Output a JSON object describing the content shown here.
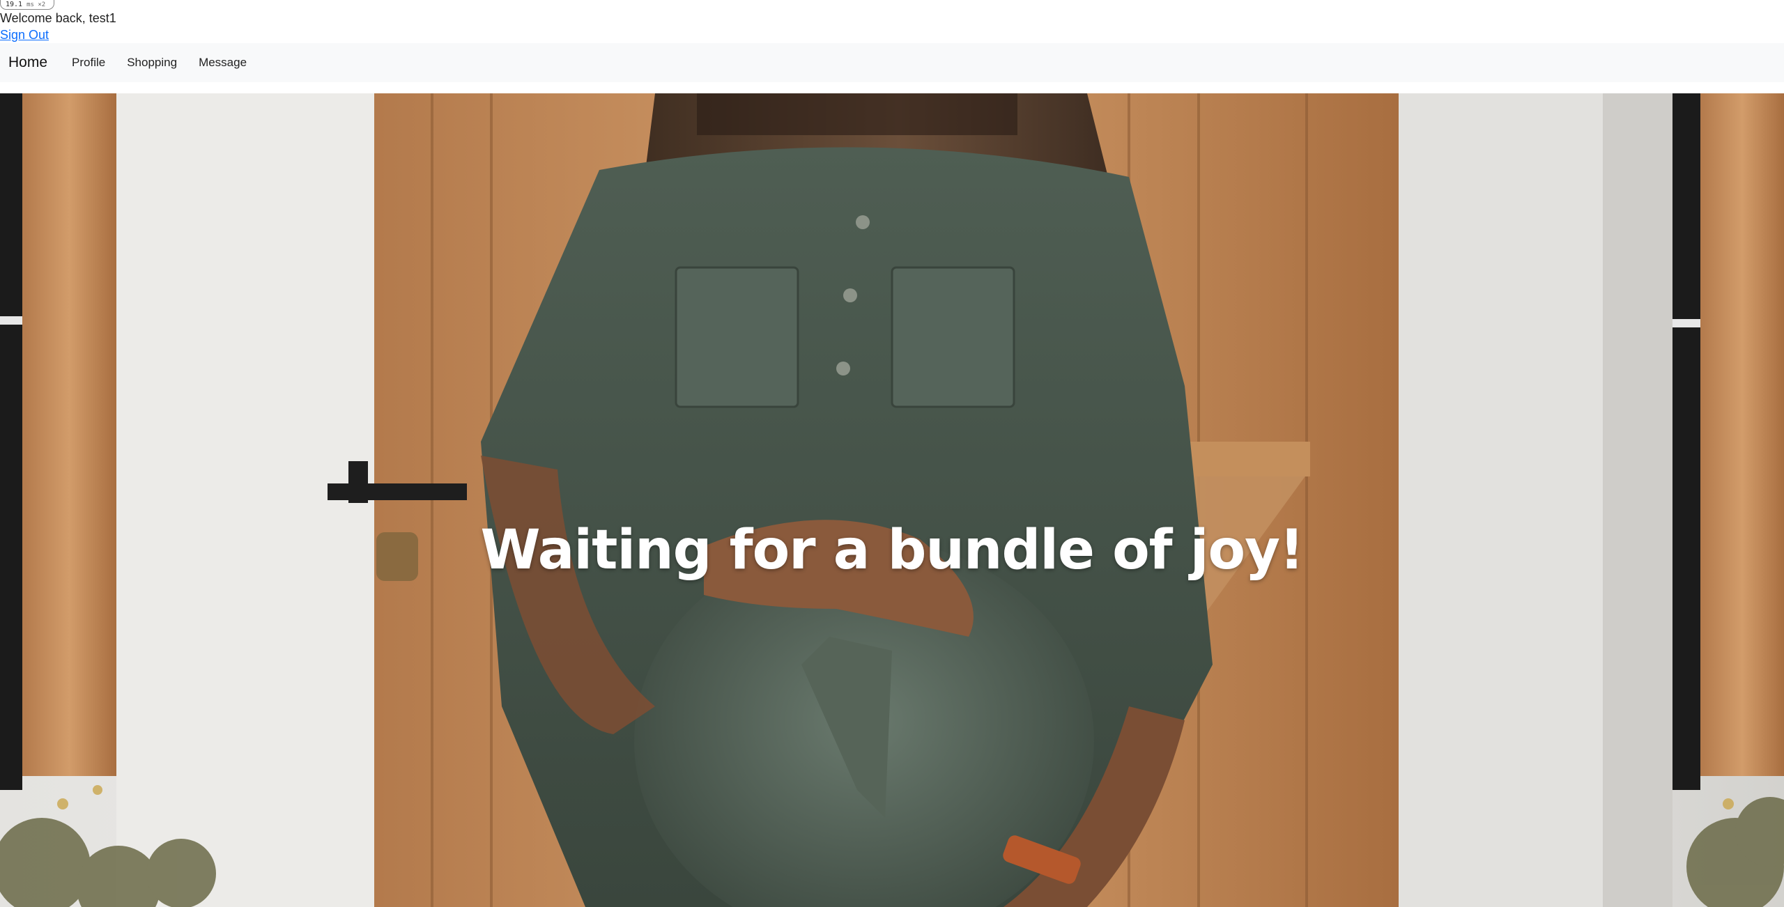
{
  "perf_badge": {
    "value": "19.1",
    "unit": "ms ×2"
  },
  "header": {
    "welcome_text": "Welcome back, test1",
    "sign_out_label": "Sign Out"
  },
  "navbar": {
    "brand": "Home",
    "links": [
      {
        "label": "Profile"
      },
      {
        "label": "Shopping"
      },
      {
        "label": "Message"
      }
    ]
  },
  "hero": {
    "title": "Waiting for a bundle of joy!",
    "image_description_icon": "pregnant-woman-photo"
  },
  "colors": {
    "navbar_bg": "#f8f9fa",
    "link": "#0d6efd",
    "hero_text": "#ffffff"
  }
}
